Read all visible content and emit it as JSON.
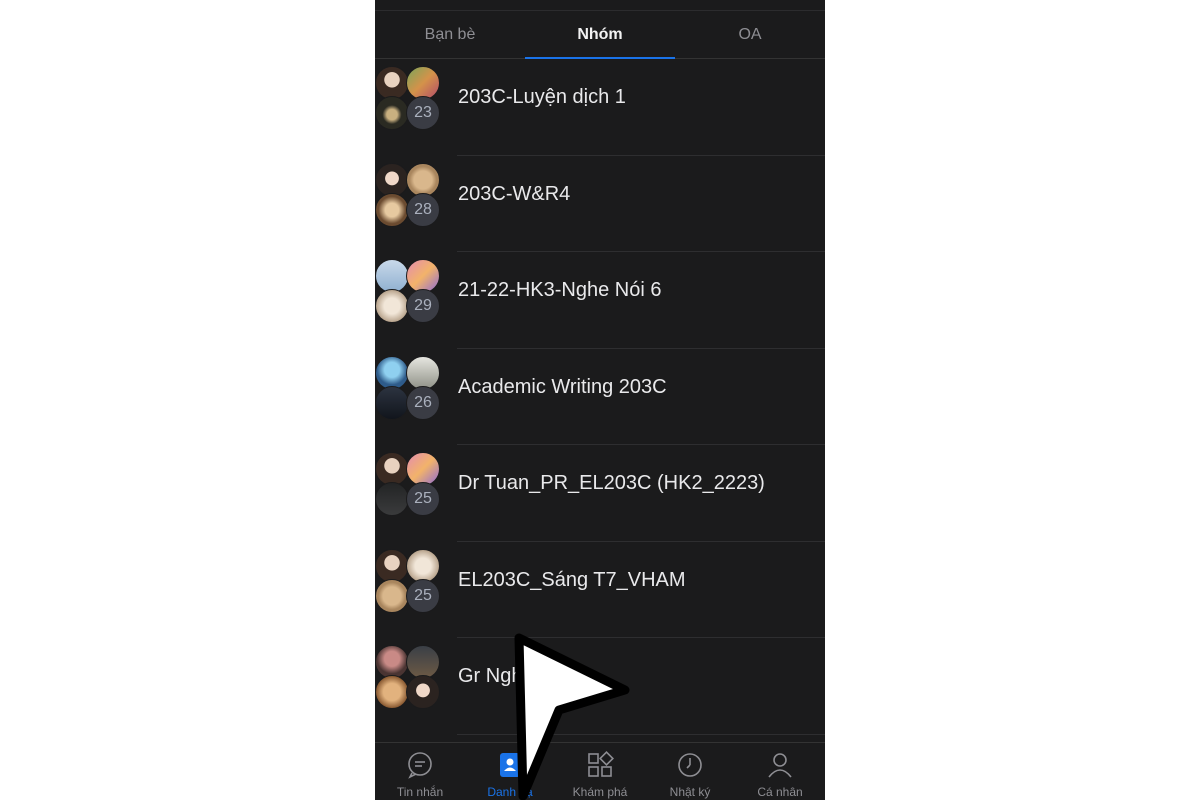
{
  "tabs": [
    {
      "label": "Bạn bè"
    },
    {
      "label": "Nhóm"
    },
    {
      "label": "OA"
    }
  ],
  "groups": [
    {
      "name": "203C-Luyện dịch 1",
      "member_count": "23"
    },
    {
      "name": "203C-W&R4",
      "member_count": "28"
    },
    {
      "name": "21-22-HK3-Nghe Nói 6",
      "member_count": "29"
    },
    {
      "name": "Academic Writing 203C",
      "member_count": "26"
    },
    {
      "name": "Dr Tuan_PR_EL203C (HK2_2223)",
      "member_count": "25"
    },
    {
      "name": "EL203C_Sáng T7_VHAM",
      "member_count": "25"
    },
    {
      "name": "Gr Nghe Nói 4",
      "member_count": ""
    }
  ],
  "bottom_nav": [
    {
      "label": "Tin nhắn",
      "icon": "chat-bubble-icon"
    },
    {
      "label": "Danh bạ",
      "icon": "contacts-icon"
    },
    {
      "label": "Khám phá",
      "icon": "grid-explore-icon"
    },
    {
      "label": "Nhật ký",
      "icon": "clock-icon"
    },
    {
      "label": "Cá nhân",
      "icon": "person-icon"
    }
  ],
  "colors": {
    "accent": "#1a73e8",
    "background": "#1b1b1c",
    "text_primary": "#e9e9eb",
    "text_secondary": "#8e8e93"
  }
}
